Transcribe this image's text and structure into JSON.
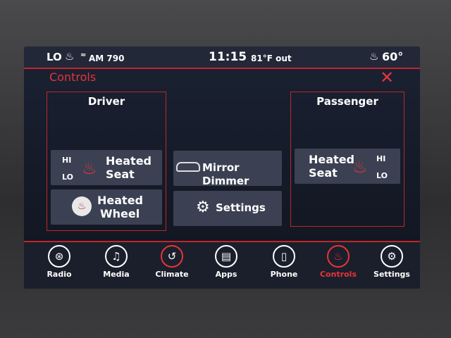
{
  "status_bar": {
    "fan_level": "LO",
    "radio_source": "AM 790",
    "time": "11:15",
    "outside_temp": "81°F out",
    "set_temp": "60°"
  },
  "header": {
    "title": "Controls",
    "close_icon": "close-icon"
  },
  "driver": {
    "title": "Driver",
    "heated_seat": {
      "label_line1": "Heated",
      "label_line2": "Seat",
      "hi": "HI",
      "lo": "LO"
    },
    "heated_wheel": {
      "label_line1": "Heated",
      "label_line2": "Wheel"
    }
  },
  "center": {
    "mirror_dimmer": "Mirror Dimmer",
    "settings": "Settings"
  },
  "passenger": {
    "title": "Passenger",
    "heated_seat": {
      "label_line1": "Heated",
      "label_line2": "Seat",
      "hi": "HI",
      "lo": "LO"
    }
  },
  "nav": {
    "items": [
      {
        "label": "Radio",
        "icon": "radio-icon"
      },
      {
        "label": "Media",
        "icon": "music-note-icon"
      },
      {
        "label": "Climate",
        "icon": "climate-icon"
      },
      {
        "label": "Apps",
        "icon": "apps-icon"
      },
      {
        "label": "Phone",
        "icon": "phone-icon"
      },
      {
        "label": "Controls",
        "icon": "controls-icon",
        "active": true
      },
      {
        "label": "Settings",
        "icon": "gear-icon"
      }
    ]
  },
  "colors": {
    "accent": "#e8333a",
    "panel_bg": "#3b4152"
  }
}
